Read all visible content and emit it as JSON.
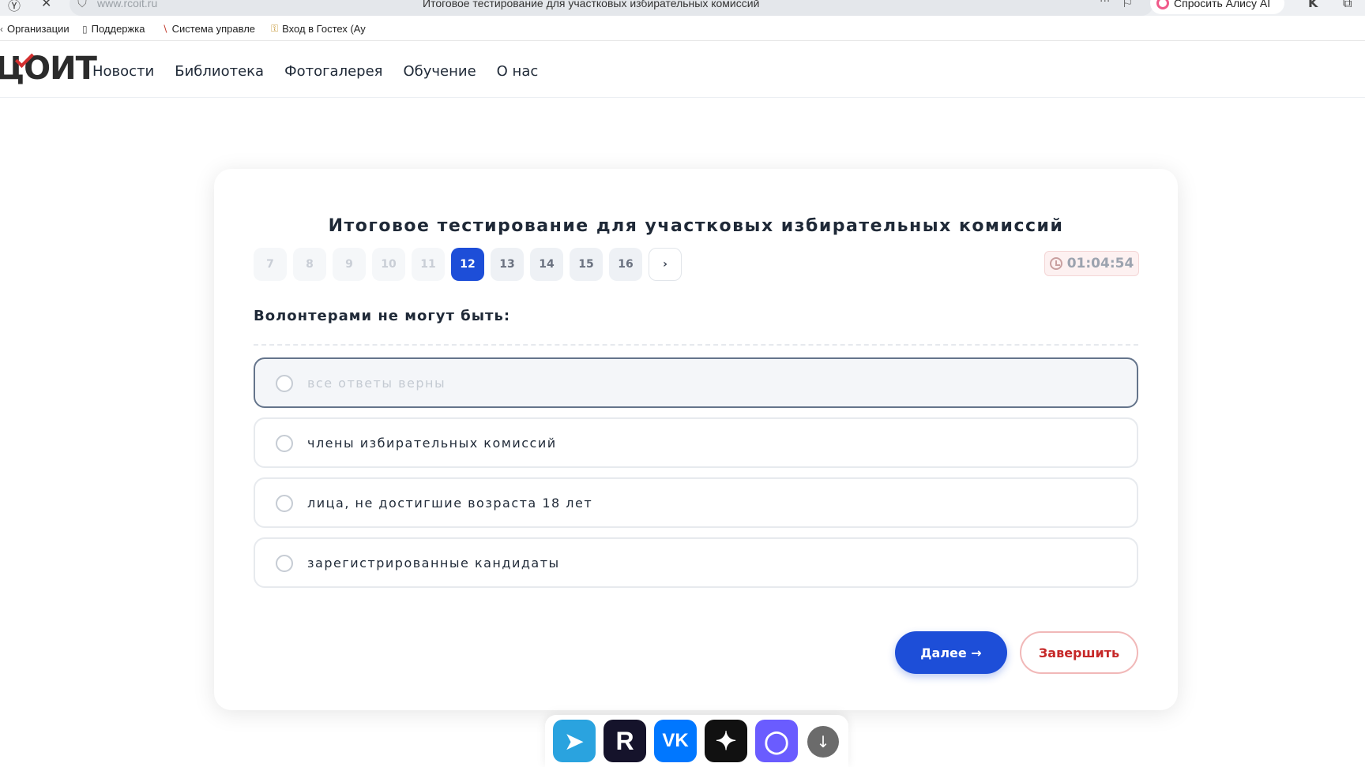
{
  "browser": {
    "url": "www.rcoit.ru",
    "tab_title": "Итоговое тестирование для участковых избирательных комиссий",
    "more": "···",
    "alice_label": "Спросить Алису AI",
    "bookmarks": [
      "Организации",
      "Поддержка",
      "Система управле",
      "Вход в Гостех (Ау"
    ]
  },
  "site": {
    "logo": "ЦОИТ",
    "nav": [
      "Новости",
      "Библиотека",
      "Фотогалерея",
      "Обучение",
      "О нас"
    ]
  },
  "quiz": {
    "title": "Итоговое тестирование для участковых избирательных комиссий",
    "pages": [
      "7",
      "8",
      "9",
      "10",
      "11",
      "12",
      "13",
      "14",
      "15",
      "16"
    ],
    "current_page": "12",
    "next_page_arrow": "›",
    "timer": "01:04:54",
    "question": "Волонтерами не могут быть:",
    "options": [
      "все ответы верны",
      "члены избирательных комиссий",
      "лица, не достигшие возраста 18 лет",
      "зарегистрированные кандидаты"
    ],
    "next_label": "Далее →",
    "finish_label": "Завершить"
  },
  "dock": {
    "apps": [
      "telegram-icon",
      "rutube-icon",
      "vk-icon",
      "star-app-icon",
      "max-messenger-icon"
    ],
    "download_glyph": "↓"
  },
  "colors": {
    "accent": "#1d4ed8",
    "finish": "#c62828"
  }
}
